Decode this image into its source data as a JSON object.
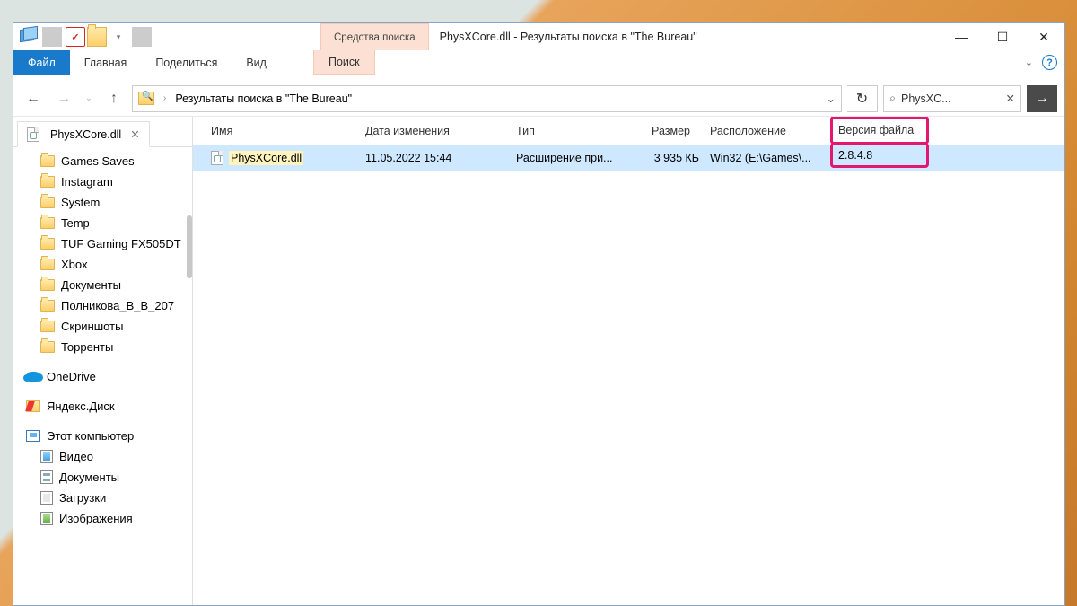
{
  "titlebar": {
    "searchtools_label": "Средства поиска",
    "title": "PhysXCore.dll - Результаты поиска в \"The Bureau\""
  },
  "ribbon": {
    "file": "Файл",
    "home": "Главная",
    "share": "Поделиться",
    "view": "Вид",
    "search": "Поиск"
  },
  "address": {
    "path": "Результаты поиска в \"The Bureau\""
  },
  "search": {
    "text": "PhysXC..."
  },
  "filetab": {
    "label": "PhysXCore.dll"
  },
  "sidebar": {
    "folders": [
      "Games Saves",
      "Instagram",
      "System",
      "Temp",
      "TUF Gaming FX505DT",
      "Xbox",
      "Документы",
      "Полникова_В_В_207",
      "Скриншоты",
      "Торренты"
    ],
    "onedrive": "OneDrive",
    "yadisk": "Яндекс.Диск",
    "thispc": "Этот компьютер",
    "libs": [
      "Видео",
      "Документы",
      "Загрузки",
      "Изображения"
    ]
  },
  "columns": {
    "name": "Имя",
    "date": "Дата изменения",
    "type": "Тип",
    "size": "Размер",
    "location": "Расположение",
    "version": "Версия файла"
  },
  "row": {
    "name": "PhysXCore.dll",
    "date": "11.05.2022 15:44",
    "type": "Расширение при...",
    "size": "3 935 КБ",
    "location": "Win32 (E:\\Games\\...",
    "version": "2.8.4.8"
  }
}
